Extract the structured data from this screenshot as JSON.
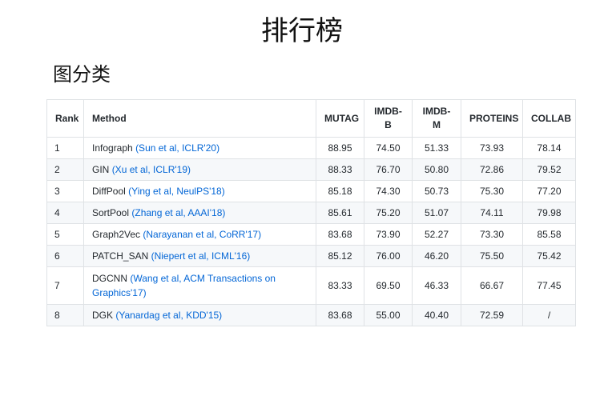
{
  "page": {
    "title": "排行榜",
    "section": "图分类"
  },
  "table": {
    "headers": [
      "Rank",
      "Method",
      "MUTAG",
      "IMDB-B",
      "IMDB-M",
      "PROTEINS",
      "COLLAB"
    ],
    "rows": [
      {
        "rank": "1",
        "method": "Infograph",
        "ref": "(Sun et al, ICLR'20)",
        "mutag": "88.95",
        "imdb_b": "74.50",
        "imdb_m": "51.33",
        "proteins": "73.93",
        "collab": "78.14"
      },
      {
        "rank": "2",
        "method": "GIN",
        "ref": "(Xu et al, ICLR'19)",
        "mutag": "88.33",
        "imdb_b": "76.70",
        "imdb_m": "50.80",
        "proteins": "72.86",
        "collab": "79.52"
      },
      {
        "rank": "3",
        "method": "DiffPool",
        "ref": "(Ying et al, NeulPS'18)",
        "mutag": "85.18",
        "imdb_b": "74.30",
        "imdb_m": "50.73",
        "proteins": "75.30",
        "collab": "77.20"
      },
      {
        "rank": "4",
        "method": "SortPool",
        "ref": "(Zhang et al, AAAI'18)",
        "mutag": "85.61",
        "imdb_b": "75.20",
        "imdb_m": "51.07",
        "proteins": "74.11",
        "collab": "79.98"
      },
      {
        "rank": "5",
        "method": "Graph2Vec",
        "ref": "(Narayanan et al, CoRR'17)",
        "mutag": "83.68",
        "imdb_b": "73.90",
        "imdb_m": "52.27",
        "proteins": "73.30",
        "collab": "85.58"
      },
      {
        "rank": "6",
        "method": "PATCH_SAN",
        "ref": "(Niepert et al, ICML'16)",
        "mutag": "85.12",
        "imdb_b": "76.00",
        "imdb_m": "46.20",
        "proteins": "75.50",
        "collab": "75.42"
      },
      {
        "rank": "7",
        "method": "DGCNN",
        "ref": "(Wang et al, ACM Transactions on Graphics'17)",
        "mutag": "83.33",
        "imdb_b": "69.50",
        "imdb_m": "46.33",
        "proteins": "66.67",
        "collab": "77.45"
      },
      {
        "rank": "8",
        "method": "DGK",
        "ref": "(Yanardag et al, KDD'15)",
        "mutag": "83.68",
        "imdb_b": "55.00",
        "imdb_m": "40.40",
        "proteins": "72.59",
        "collab": "/"
      }
    ]
  }
}
